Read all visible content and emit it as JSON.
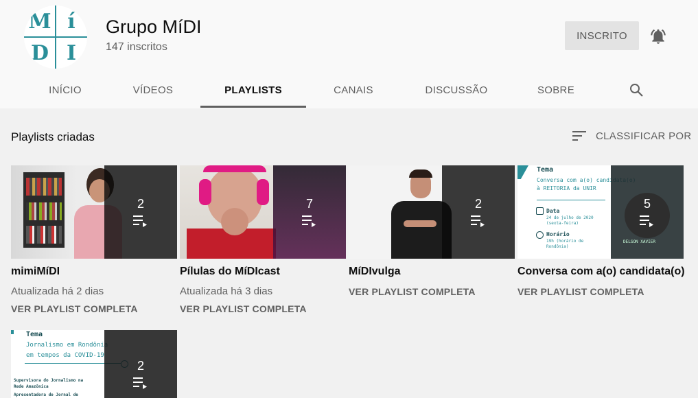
{
  "channel": {
    "name": "Grupo MíDI",
    "subscribers": "147 inscritos",
    "subscribe_label": "INSCRITO",
    "avatar_letters": [
      "M",
      "í",
      "D",
      "I"
    ]
  },
  "tabs": [
    "INÍCIO",
    "VÍDEOS",
    "PLAYLISTS",
    "CANAIS",
    "DISCUSSÃO",
    "SOBRE"
  ],
  "active_tab": "PLAYLISTS",
  "section": {
    "title": "Playlists criadas",
    "sort_label": "CLASSIFICAR POR"
  },
  "playlists": [
    {
      "title": "mimiMíDI",
      "count": "2",
      "updated": "Atualizada há 2 dias",
      "link": "VER PLAYLIST COMPLETA"
    },
    {
      "title": "Pílulas do MíDIcast",
      "count": "7",
      "updated": "Atualizada há 3 dias",
      "link": "VER PLAYLIST COMPLETA"
    },
    {
      "title": "MíDIvulga",
      "count": "2",
      "link": "VER PLAYLIST COMPLETA"
    },
    {
      "title": "Conversa com a(o) candidata(o)",
      "count": "5",
      "link": "VER PLAYLIST COMPLETA",
      "slide": {
        "heading": "Tema",
        "line1": "Conversa com a(o) candidata(o)",
        "line2": "à REITORIA da UNIR",
        "date_label": "Data",
        "date_value": "24 de julho de 2020",
        "date_day": "(sexta-feira)",
        "time_label": "Horário",
        "time_value": "19h (horário de",
        "time_zone": "Rondônia)",
        "guest": "DELSON XAVIER"
      }
    },
    {
      "count": "2",
      "slide": {
        "heading": "Tema",
        "line1": "Jornalismo em Rondônia",
        "line2": "em tempos da COVID-19",
        "role1": "Supervisora do Jornalismo na",
        "role2": "Rede Amazônica",
        "role3": "Apresentadora do Jornal de"
      }
    }
  ],
  "colors": {
    "brand_teal": "#2a8f99",
    "background": "#f1f1f1",
    "header_bg": "#f9f9f9"
  },
  "icons": {
    "bell": "bell-icon",
    "search": "search-icon",
    "sort": "sort-icon",
    "playlist": "playlist-play-icon"
  }
}
